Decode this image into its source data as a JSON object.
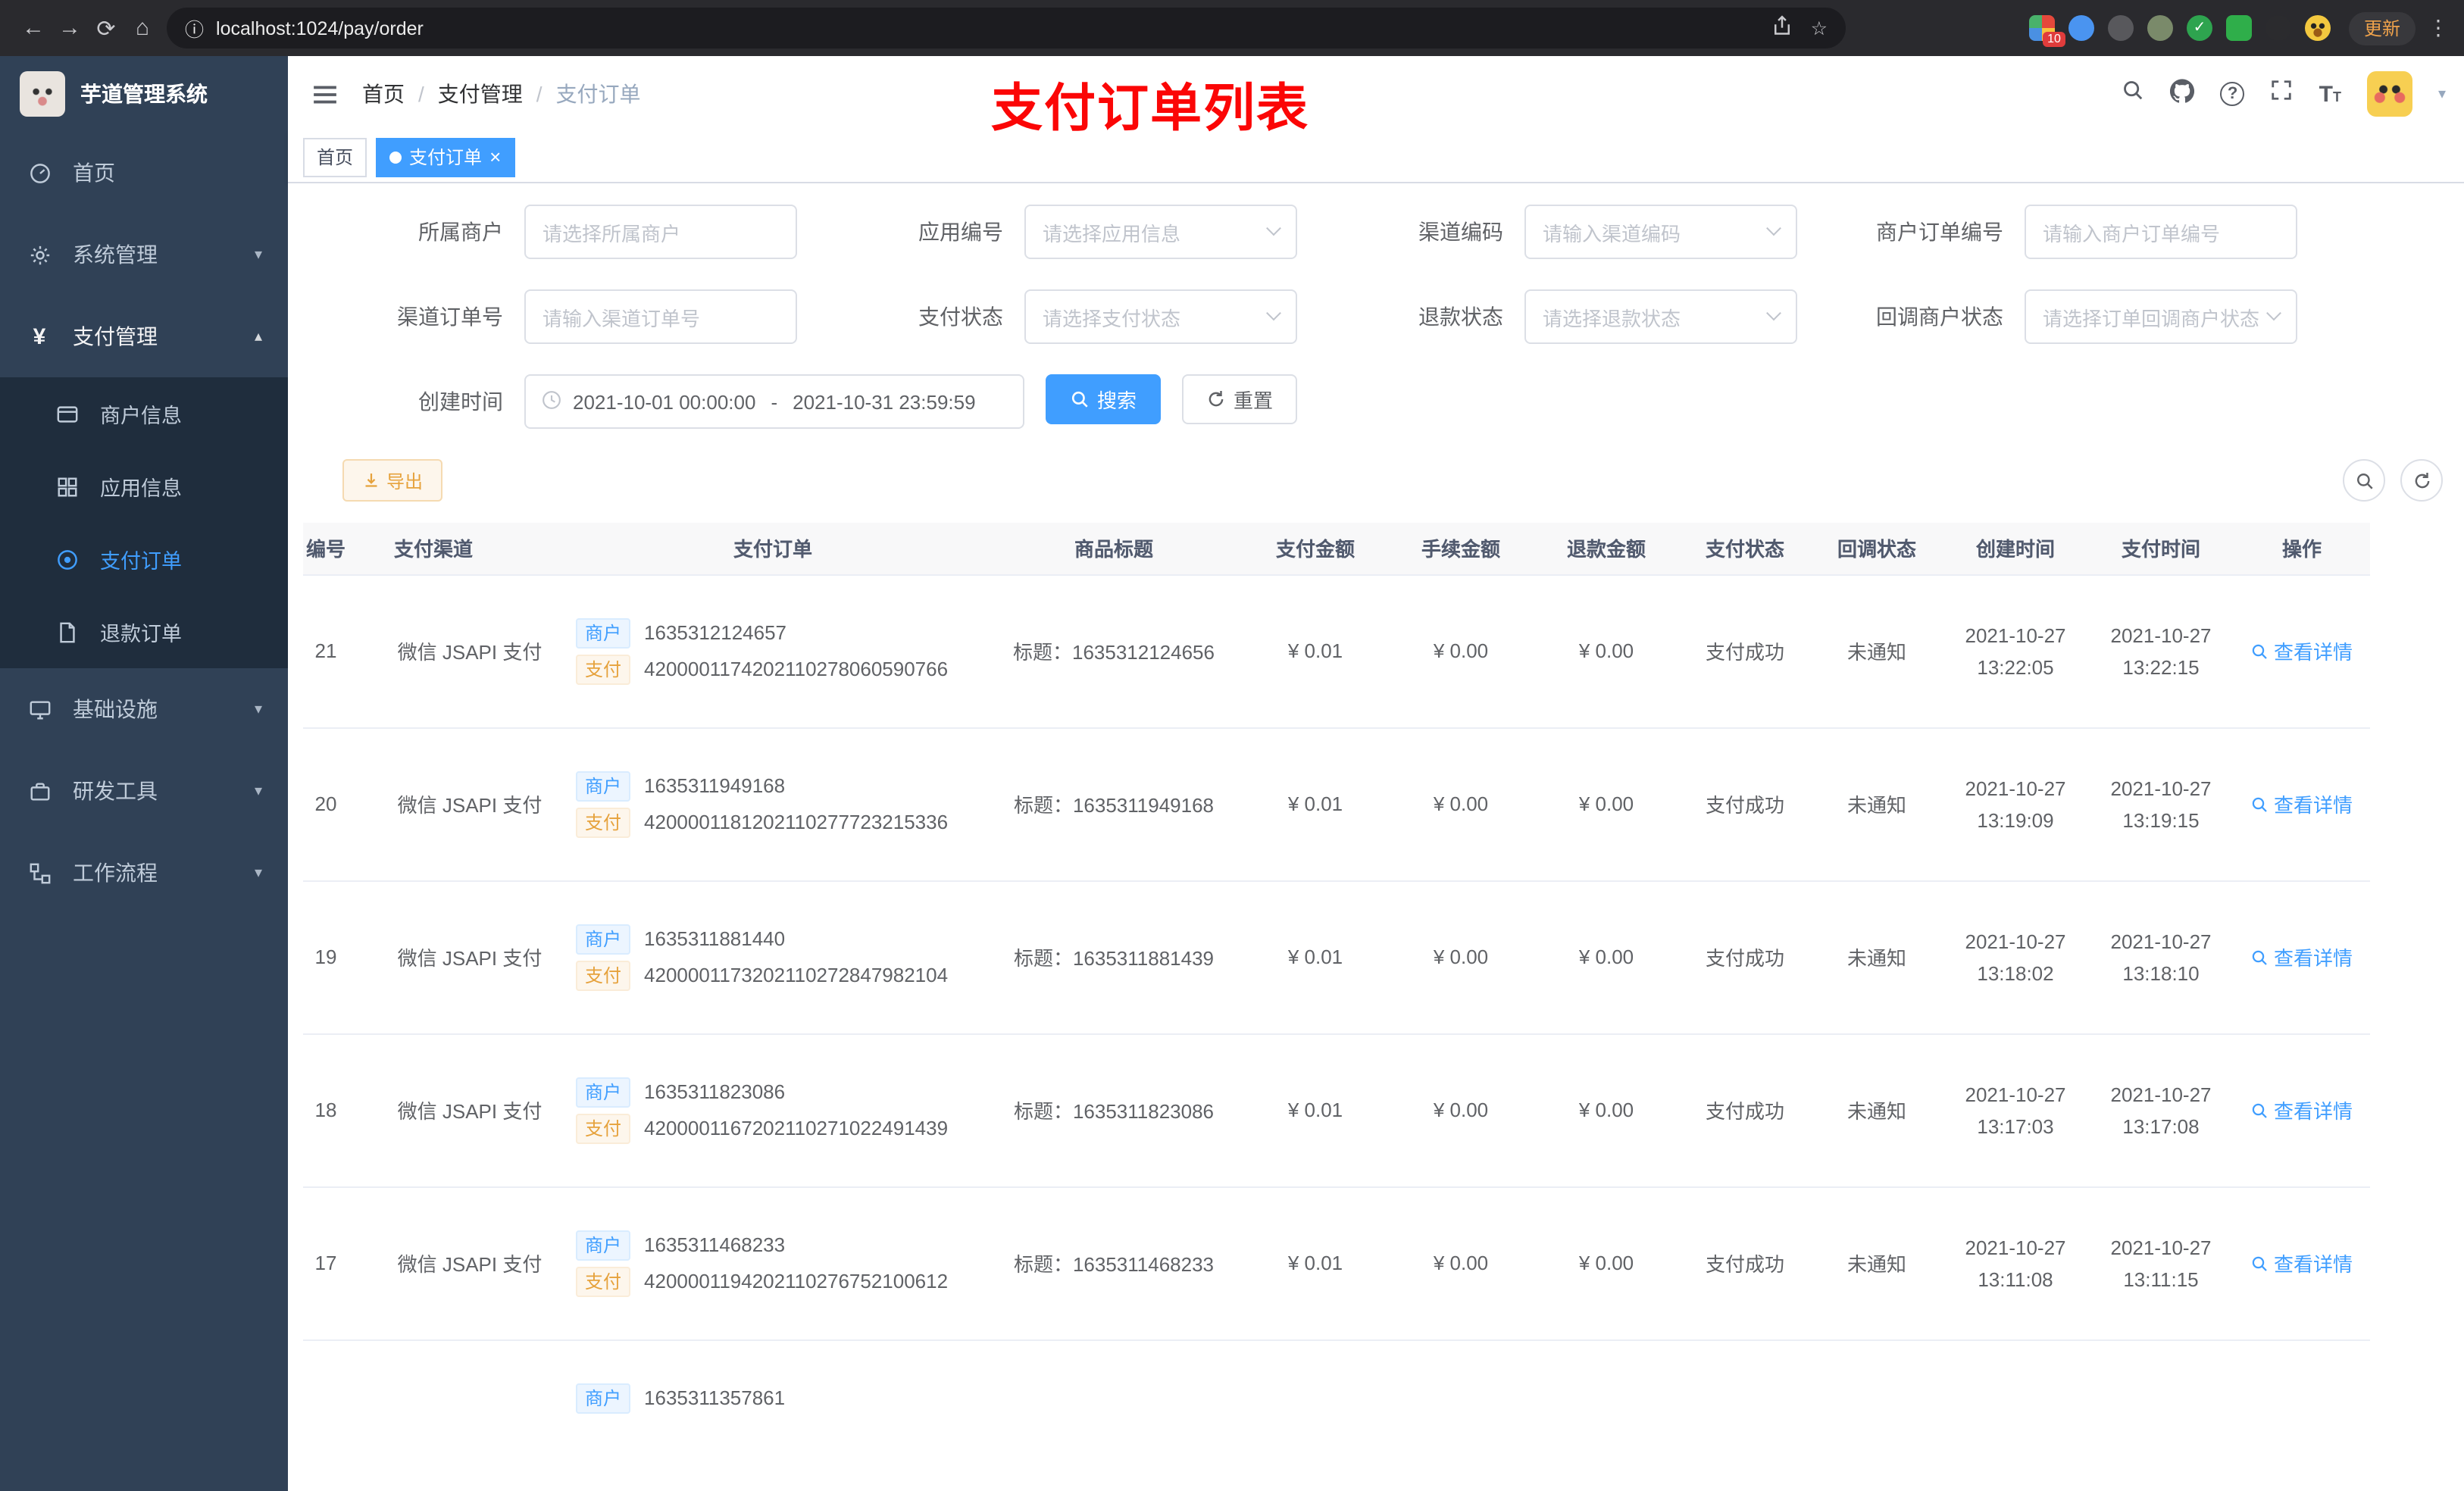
{
  "glyphs": {
    "back": "←",
    "forward": "→",
    "reload": "⟳",
    "home": "⌂",
    "info": "ⓘ",
    "star": "☆",
    "menu_dots": "⋮",
    "caret_down": "▾",
    "caret_up": "▴",
    "close": "×",
    "separator": "/",
    "range_sep": "-",
    "check": "✓",
    "question": "?",
    "font_T_big": "T",
    "font_T_small": "T",
    "yen": "¥"
  },
  "browser": {
    "url": "localhost:1024/pay/order",
    "update_label": "更新",
    "extension_badge": "10"
  },
  "app_title": "芋道管理系统",
  "sidebar": {
    "items": [
      {
        "label": "首页"
      },
      {
        "label": "系统管理"
      },
      {
        "label": "支付管理"
      },
      {
        "label": "基础设施"
      },
      {
        "label": "研发工具"
      },
      {
        "label": "工作流程"
      }
    ],
    "pay_children": [
      {
        "label": "商户信息"
      },
      {
        "label": "应用信息"
      },
      {
        "label": "支付订单"
      },
      {
        "label": "退款订单"
      }
    ]
  },
  "header": {
    "breadcrumb": [
      "首页",
      "支付管理",
      "支付订单"
    ],
    "annotation": "支付订单列表"
  },
  "tabs": [
    {
      "label": "首页"
    },
    {
      "label": "支付订单"
    }
  ],
  "filters": {
    "fields": [
      {
        "label": "所属商户",
        "placeholder": "请选择所属商户"
      },
      {
        "label": "应用编号",
        "placeholder": "请选择应用信息"
      },
      {
        "label": "渠道编码",
        "placeholder": "请输入渠道编码"
      },
      {
        "label": "商户订单编号",
        "placeholder": "请输入商户订单编号"
      },
      {
        "label": "渠道订单号",
        "placeholder": "请输入渠道订单号"
      },
      {
        "label": "支付状态",
        "placeholder": "请选择支付状态"
      },
      {
        "label": "退款状态",
        "placeholder": "请选择退款状态"
      },
      {
        "label": "回调商户状态",
        "placeholder": "请选择订单回调商户状态"
      }
    ],
    "date_label": "创建时间",
    "date_start": "2021-10-01 00:00:00",
    "date_end": "2021-10-31 23:59:59",
    "search_label": "搜索",
    "reset_label": "重置",
    "export_label": "导出"
  },
  "table": {
    "columns": [
      "编号",
      "支付渠道",
      "支付订单",
      "商品标题",
      "支付金额",
      "手续金额",
      "退款金额",
      "支付状态",
      "回调状态",
      "创建时间",
      "支付时间",
      "操作"
    ],
    "merchant_tag": "商户",
    "pay_tag": "支付",
    "action_label": "查看详情",
    "rows": [
      {
        "id": "21",
        "channel": "微信 JSAPI 支付",
        "merchant_no": "1635312124657",
        "pay_no": "4200001174202110278060590766",
        "title": "标题：1635312124656",
        "amount": "¥ 0.01",
        "fee": "¥ 0.00",
        "refund": "¥ 0.00",
        "status": "支付成功",
        "notify": "未通知",
        "created_date": "2021-10-27",
        "created_time": "13:22:05",
        "paid_date": "2021-10-27",
        "paid_time": "13:22:15"
      },
      {
        "id": "20",
        "channel": "微信 JSAPI 支付",
        "merchant_no": "1635311949168",
        "pay_no": "4200001181202110277723215336",
        "title": "标题：1635311949168",
        "amount": "¥ 0.01",
        "fee": "¥ 0.00",
        "refund": "¥ 0.00",
        "status": "支付成功",
        "notify": "未通知",
        "created_date": "2021-10-27",
        "created_time": "13:19:09",
        "paid_date": "2021-10-27",
        "paid_time": "13:19:15"
      },
      {
        "id": "19",
        "channel": "微信 JSAPI 支付",
        "merchant_no": "1635311881440",
        "pay_no": "4200001173202110272847982104",
        "title": "标题：1635311881439",
        "amount": "¥ 0.01",
        "fee": "¥ 0.00",
        "refund": "¥ 0.00",
        "status": "支付成功",
        "notify": "未通知",
        "created_date": "2021-10-27",
        "created_time": "13:18:02",
        "paid_date": "2021-10-27",
        "paid_time": "13:18:10"
      },
      {
        "id": "18",
        "channel": "微信 JSAPI 支付",
        "merchant_no": "1635311823086",
        "pay_no": "4200001167202110271022491439",
        "title": "标题：1635311823086",
        "amount": "¥ 0.01",
        "fee": "¥ 0.00",
        "refund": "¥ 0.00",
        "status": "支付成功",
        "notify": "未通知",
        "created_date": "2021-10-27",
        "created_time": "13:17:03",
        "paid_date": "2021-10-27",
        "paid_time": "13:17:08"
      },
      {
        "id": "17",
        "channel": "微信 JSAPI 支付",
        "merchant_no": "1635311468233",
        "pay_no": "4200001194202110276752100612",
        "title": "标题：1635311468233",
        "amount": "¥ 0.01",
        "fee": "¥ 0.00",
        "refund": "¥ 0.00",
        "status": "支付成功",
        "notify": "未通知",
        "created_date": "2021-10-27",
        "created_time": "13:11:08",
        "paid_date": "2021-10-27",
        "paid_time": "13:11:15"
      }
    ],
    "partial_row": {
      "merchant_no": "1635311357861"
    }
  },
  "colors": {
    "primary": "#409eff",
    "warning": "#e6a23c",
    "sidebar_bg": "#304156",
    "submenu_bg": "#1f2d3d",
    "annotation_red": "#fb0606"
  }
}
